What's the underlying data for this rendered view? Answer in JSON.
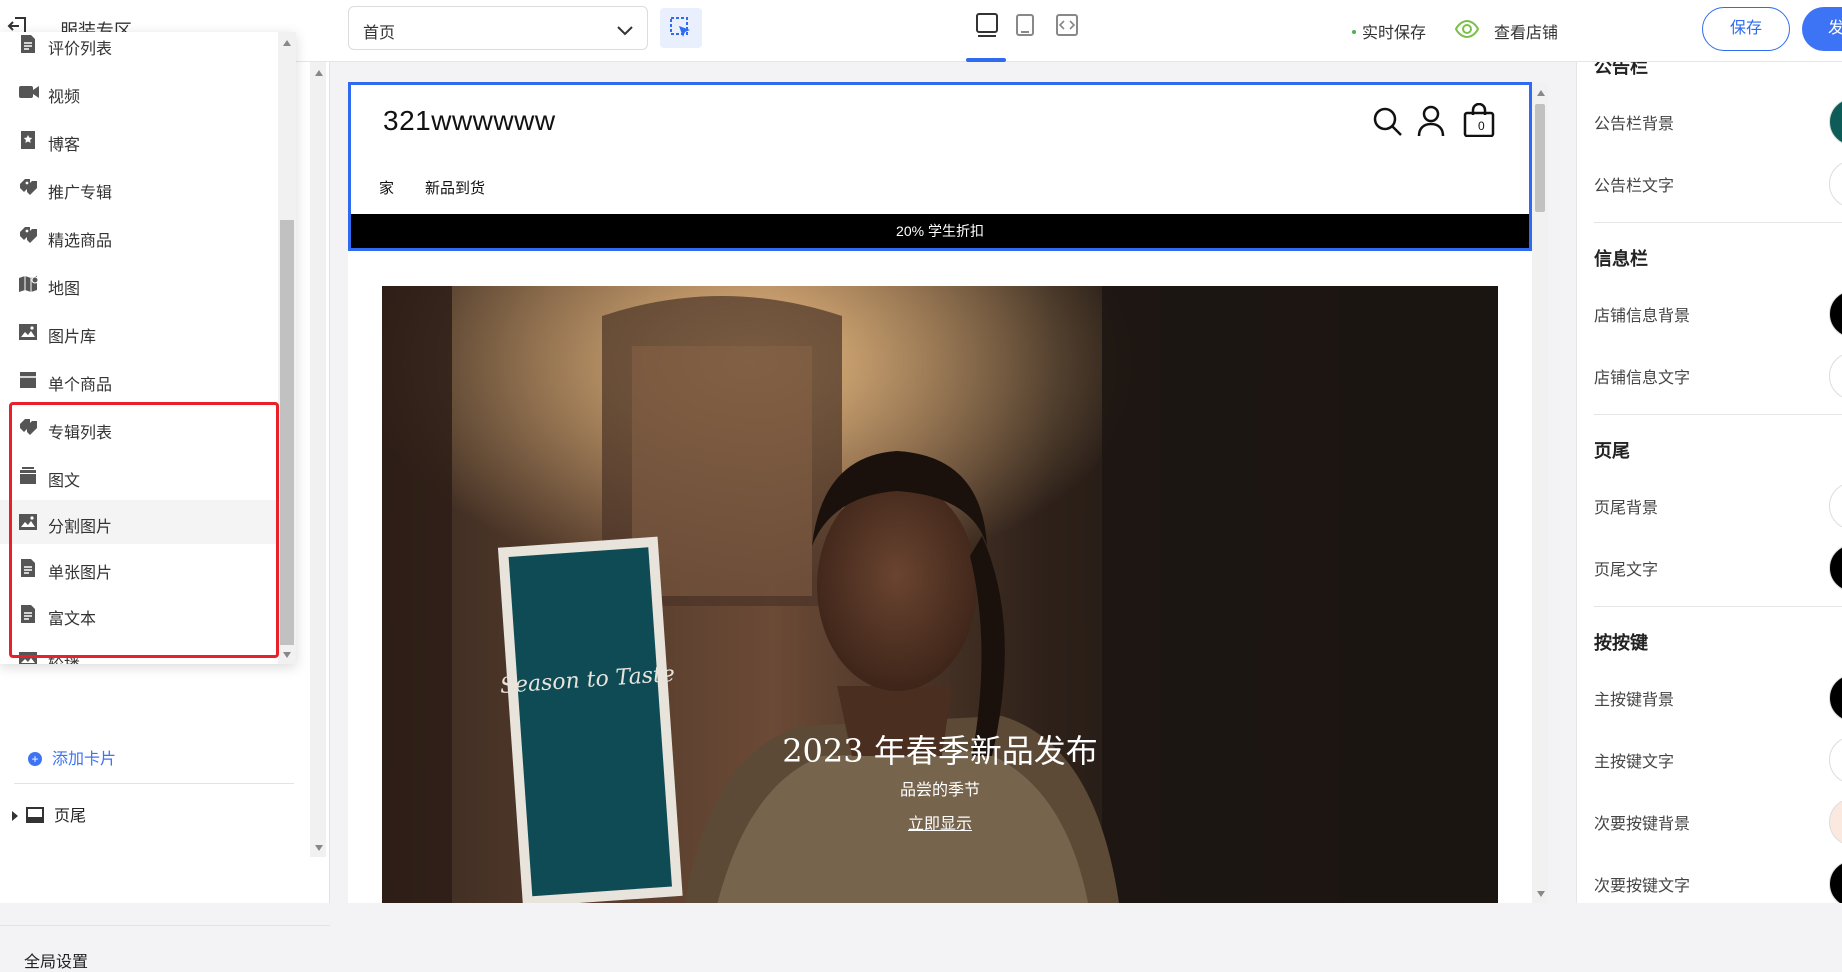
{
  "topbar": {
    "store_name": "服装专区",
    "page_select": "首页",
    "autosave": "实时保存",
    "view_store": "查看店铺",
    "save": "保存",
    "publish": "发"
  },
  "card_menu": {
    "items": [
      {
        "label": "评价列表",
        "icon": "review-list-icon"
      },
      {
        "label": "视频",
        "icon": "video-icon"
      },
      {
        "label": "博客",
        "icon": "blog-icon"
      },
      {
        "label": "推广专辑",
        "icon": "promo-collection-icon"
      },
      {
        "label": "精选商品",
        "icon": "featured-products-icon"
      },
      {
        "label": "地图",
        "icon": "map-icon"
      },
      {
        "label": "图片库",
        "icon": "gallery-icon"
      },
      {
        "label": "单个商品",
        "icon": "single-product-icon"
      },
      {
        "label": "专辑列表",
        "icon": "collection-list-icon"
      },
      {
        "label": "图文",
        "icon": "image-text-icon"
      },
      {
        "label": "分割图片",
        "icon": "split-image-icon"
      },
      {
        "label": "单张图片",
        "icon": "single-image-icon"
      },
      {
        "label": "富文本",
        "icon": "rich-text-icon"
      },
      {
        "label": "轮播",
        "icon": "carousel-icon"
      }
    ]
  },
  "left_panel": {
    "add_card": "添加卡片",
    "footer_node": "页尾",
    "global_settings": "全局设置"
  },
  "preview": {
    "shop_title": "321wwwwww",
    "cart_count": "0",
    "nav": [
      "家",
      "新品到货"
    ],
    "announcement": "20% 学生折扣",
    "hero": {
      "title": "2023 年春季新品发布",
      "subtitle": "品尝的季节",
      "link": "立即显示",
      "sign_text": "Season to Taste"
    }
  },
  "right_panel": {
    "sections": [
      {
        "title": "公告栏",
        "rows": [
          {
            "label": "公告栏背景",
            "color": "#0d5c57"
          },
          {
            "label": "公告栏文字",
            "color": "#ffffff"
          }
        ]
      },
      {
        "title": "信息栏",
        "rows": [
          {
            "label": "店铺信息背景",
            "color": "#000000"
          },
          {
            "label": "店铺信息文字",
            "color": "#ffffff"
          }
        ]
      },
      {
        "title": "页尾",
        "rows": [
          {
            "label": "页尾背景",
            "color": "#ffffff"
          },
          {
            "label": "页尾文字",
            "color": "#000000"
          }
        ]
      },
      {
        "title": "按按键",
        "rows": [
          {
            "label": "主按键背景",
            "color": "#000000"
          },
          {
            "label": "主按键文字",
            "color": "#ffffff"
          },
          {
            "label": "次要按键背景",
            "color": "#fbe9df"
          },
          {
            "label": "次要按键文字",
            "color": "#000000"
          }
        ]
      }
    ]
  },
  "colors": {
    "accent": "#2f6bf0",
    "highlight_box": "#e8202a"
  }
}
